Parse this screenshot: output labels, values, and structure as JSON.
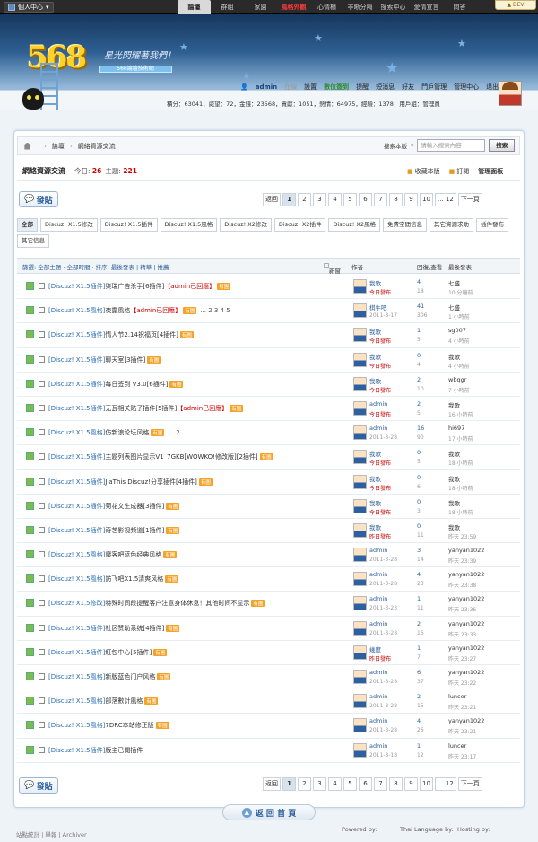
{
  "topbar": {
    "personal": "個人中心",
    "nav": [
      "論壇",
      "群組",
      "家園",
      "風格外觀",
      "心情櫃",
      "非晰分隔",
      "搜索中心",
      "愛情宣言",
      "問答"
    ],
    "dev": "DEV"
  },
  "header": {
    "logo": "568",
    "slogan": "星光閃耀著我們！",
    "sub": "568論壇技術網",
    "user": "admin",
    "online_label": "在線",
    "settings": "設置",
    "checkin": "數位簽到",
    "remind": "提醒",
    "pm": "短消息",
    "friends": "好友",
    "portal": "門戶管理",
    "admin_center": "管理中心",
    "logout": "退出",
    "stats": "積分：63041，威望：72，金錢：23568，貢獻：1051，熱情：64975，經驗：1378，用戶組：管理員"
  },
  "breadcrumb": {
    "home": "首頁",
    "forum": "論壇",
    "current": "網絡資源交流"
  },
  "search": {
    "label": "搜索本版",
    "placeholder": "請輸入搜索內容",
    "button": "搜索"
  },
  "forum": {
    "title": "網絡資源交流",
    "today_label": "今日:",
    "today": "26",
    "topics_label": "主題:",
    "topics": "221",
    "fav": "收藏本版",
    "rss": "訂閱",
    "admin": "管理面板"
  },
  "post_button": "發貼",
  "pager": {
    "prev": "返回",
    "pages": [
      "1",
      "2",
      "3",
      "4",
      "5",
      "6",
      "7",
      "8",
      "9",
      "10"
    ],
    "last": "... 12",
    "next": "下一頁"
  },
  "tags": [
    "全部",
    "Discuz! X1.5修改",
    "Discuz! X1.5插件",
    "Discuz! X1.5風格",
    "Discuz! X2修改",
    "Discuz! X2插件",
    "Discuz! X2風格",
    "免費空間信息",
    "其它資源求助",
    "插件發布",
    "其它信息"
  ],
  "toolbar": {
    "filter": "篩選: 全部主題 · 全部時間 · 排序: 最後發表 | 精華 | 推薦",
    "new": "新窗",
    "author": "作者",
    "replies": "回復/查看",
    "last": "最後發表"
  },
  "threads": [
    {
      "cat": "[Discuz! X1.5插件]",
      "title": "柒瑞广告杀手[6插件]",
      "red": "【admin已回應】",
      "tag": "有圖",
      "pages": "",
      "au": "我歌",
      "ad": "今日發布",
      "r": "4",
      "v": "18",
      "lu": "七盛",
      "lt": "10 分鐘前"
    },
    {
      "cat": "[Discuz! X1.5風格]",
      "title": "夜露風格",
      "red": "【admin已回應】",
      "tag": "有圖",
      "pages": "... 2 3 4 5",
      "au": "棋牛吧",
      "ad": "2011-3-17",
      "r": "41",
      "v": "306",
      "lu": "七盛",
      "lt": "1 小時前"
    },
    {
      "cat": "[Discuz! X1.5插件]",
      "title": "情人节2.14祝福页[4插件]",
      "red": "",
      "tag": "有圖",
      "pages": "",
      "au": "我歌",
      "ad": "今日發布",
      "r": "1",
      "v": "5",
      "lu": "sg007",
      "lt": "4 小時前"
    },
    {
      "cat": "[Discuz! X1.5插件]",
      "title": "聊天室[3插件]",
      "red": "",
      "tag": "有圖",
      "pages": "",
      "au": "我歌",
      "ad": "今日發布",
      "r": "0",
      "v": "4",
      "lu": "我歌",
      "lt": "4 小時前"
    },
    {
      "cat": "[Discuz! X1.5插件]",
      "title": "每日签到 V3.0[6插件]",
      "red": "",
      "tag": "有圖",
      "pages": "",
      "au": "我歌",
      "ad": "今日發布",
      "r": "2",
      "v": "10",
      "lu": "wbqgr",
      "lt": "7 小時前"
    },
    {
      "cat": "[Discuz! X1.5插件]",
      "title": "无瓦相关贴子插件[5插件]",
      "red": "【admin已回應】",
      "tag": "有圖",
      "pages": "",
      "au": "admin",
      "ad": "今日發布",
      "r": "2",
      "v": "5",
      "lu": "我歌",
      "lt": "16 小時前"
    },
    {
      "cat": "[Discuz! X1.5風格]",
      "title": "仿新浪论坛风格",
      "red": "",
      "tag": "有圖",
      "pages": "... 2",
      "au": "admin",
      "ad": "2011-3-28",
      "r": "16",
      "v": "90",
      "lu": "hi697",
      "lt": "17 小時前"
    },
    {
      "cat": "[Discuz! X1.5插件]",
      "title": "主题列表图片显示V1_7GKB[WOWKO!修改版][2插件]",
      "red": "",
      "tag": "有圖",
      "pages": "",
      "au": "我歌",
      "ad": "今日發布",
      "r": "0",
      "v": "5",
      "lu": "我歌",
      "lt": "18 小時前"
    },
    {
      "cat": "[Discuz! X1.5插件]",
      "title": "JiaThis Discuz!分享插件[4插件]",
      "red": "",
      "tag": "有圖",
      "pages": "",
      "au": "我歌",
      "ad": "今日發布",
      "r": "0",
      "v": "6",
      "lu": "我歌",
      "lt": "18 小時前"
    },
    {
      "cat": "[Discuz! X1.5插件]",
      "title": "菊花文生成器[3插件]",
      "red": "",
      "tag": "有圖",
      "pages": "",
      "au": "我歌",
      "ad": "今日發布",
      "r": "0",
      "v": "3",
      "lu": "我歌",
      "lt": "18 小時前"
    },
    {
      "cat": "[Discuz! X1.5插件]",
      "title": "奇艺影视频道[1插件]",
      "red": "",
      "tag": "有圖",
      "pages": "",
      "au": "我歌",
      "ad": "昨日發布",
      "r": "0",
      "v": "11",
      "lu": "我歌",
      "lt": "昨天 23:59"
    },
    {
      "cat": "[Discuz! X1.5風格]",
      "title": "魔客吧蓝色经典风格",
      "red": "",
      "tag": "有圖",
      "pages": "",
      "au": "admin",
      "ad": "2011-3-28",
      "r": "3",
      "v": "14",
      "lu": "yanyan1022",
      "lt": "昨天 23:39"
    },
    {
      "cat": "[Discuz! X1.5風格]",
      "title": "訪飞吧X1.5清爽风格",
      "red": "",
      "tag": "有圖",
      "pages": "",
      "au": "admin",
      "ad": "2011-3-28",
      "r": "4",
      "v": "23",
      "lu": "yanyan1022",
      "lt": "昨天 23:38"
    },
    {
      "cat": "[Discuz! X1.5修改]",
      "title": "特殊时间段提醒客户注意身体休息！其他时间不显示",
      "red": "",
      "tag": "有圖",
      "pages": "",
      "au": "admin",
      "ad": "2011-3-23",
      "r": "1",
      "v": "11",
      "lu": "yanyan1022",
      "lt": "昨天 23:36"
    },
    {
      "cat": "[Discuz! X1.5插件]",
      "title": "社区赞助系统[4插件]",
      "red": "",
      "tag": "有圖",
      "pages": "",
      "au": "admin",
      "ad": "2011-3-28",
      "r": "2",
      "v": "16",
      "lu": "yanyan1022",
      "lt": "昨天 23:33"
    },
    {
      "cat": "[Discuz! X1.5插件]",
      "title": "紅包中心[5插件]",
      "red": "",
      "tag": "有圖",
      "pages": "",
      "au": "幾度",
      "ad": "昨日發布",
      "r": "1",
      "v": "7",
      "lu": "yanyan1022",
      "lt": "昨天 23:27"
    },
    {
      "cat": "[Discuz! X1.5風格]",
      "title": "新版蓝色门户风格",
      "red": "",
      "tag": "有圖",
      "pages": "",
      "au": "admin",
      "ad": "2011-3-28",
      "r": "6",
      "v": "37",
      "lu": "yanyan1022",
      "lt": "昨天 23:22"
    },
    {
      "cat": "[Discuz! X1.5風格]",
      "title": "部落數計風格",
      "red": "",
      "tag": "有圖",
      "pages": "",
      "au": "admin",
      "ad": "2011-3-28",
      "r": "2",
      "v": "15",
      "lu": "luncer",
      "lt": "昨天 23:21"
    },
    {
      "cat": "[Discuz! X1.5風格]",
      "title": "7DRC本站修正版",
      "red": "",
      "tag": "有圖",
      "pages": "",
      "au": "admin",
      "ad": "2011-3-28",
      "r": "4",
      "v": "26",
      "lu": "yanyan1022",
      "lt": "昨天 23:21"
    },
    {
      "cat": "[Discuz! X1.5插件]",
      "title": "版主已閱插件",
      "red": "",
      "tag": "",
      "pages": "",
      "au": "admin",
      "ad": "2011-3-18",
      "r": "1",
      "v": "12",
      "lu": "luncer",
      "lt": "昨天 23:17"
    }
  ],
  "back_top": "返 回 首 頁",
  "footer": {
    "links": "站點統計 | 舉報 | Archiver",
    "powered": "Powered by:",
    "thai": "Thai Language by:",
    "hosting": "Hosting by:"
  }
}
